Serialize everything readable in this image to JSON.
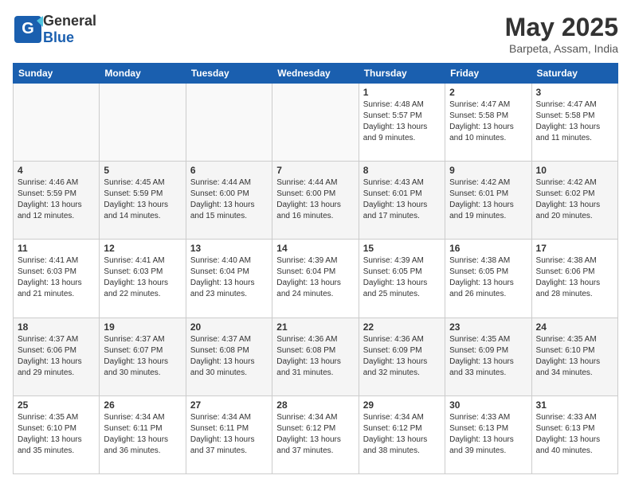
{
  "header": {
    "logo_general": "General",
    "logo_blue": "Blue",
    "month_title": "May 2025",
    "location": "Barpeta, Assam, India"
  },
  "days_of_week": [
    "Sunday",
    "Monday",
    "Tuesday",
    "Wednesday",
    "Thursday",
    "Friday",
    "Saturday"
  ],
  "weeks": [
    [
      {
        "day": "",
        "info": ""
      },
      {
        "day": "",
        "info": ""
      },
      {
        "day": "",
        "info": ""
      },
      {
        "day": "",
        "info": ""
      },
      {
        "day": "1",
        "info": "Sunrise: 4:48 AM\nSunset: 5:57 PM\nDaylight: 13 hours\nand 9 minutes."
      },
      {
        "day": "2",
        "info": "Sunrise: 4:47 AM\nSunset: 5:58 PM\nDaylight: 13 hours\nand 10 minutes."
      },
      {
        "day": "3",
        "info": "Sunrise: 4:47 AM\nSunset: 5:58 PM\nDaylight: 13 hours\nand 11 minutes."
      }
    ],
    [
      {
        "day": "4",
        "info": "Sunrise: 4:46 AM\nSunset: 5:59 PM\nDaylight: 13 hours\nand 12 minutes."
      },
      {
        "day": "5",
        "info": "Sunrise: 4:45 AM\nSunset: 5:59 PM\nDaylight: 13 hours\nand 14 minutes."
      },
      {
        "day": "6",
        "info": "Sunrise: 4:44 AM\nSunset: 6:00 PM\nDaylight: 13 hours\nand 15 minutes."
      },
      {
        "day": "7",
        "info": "Sunrise: 4:44 AM\nSunset: 6:00 PM\nDaylight: 13 hours\nand 16 minutes."
      },
      {
        "day": "8",
        "info": "Sunrise: 4:43 AM\nSunset: 6:01 PM\nDaylight: 13 hours\nand 17 minutes."
      },
      {
        "day": "9",
        "info": "Sunrise: 4:42 AM\nSunset: 6:01 PM\nDaylight: 13 hours\nand 19 minutes."
      },
      {
        "day": "10",
        "info": "Sunrise: 4:42 AM\nSunset: 6:02 PM\nDaylight: 13 hours\nand 20 minutes."
      }
    ],
    [
      {
        "day": "11",
        "info": "Sunrise: 4:41 AM\nSunset: 6:03 PM\nDaylight: 13 hours\nand 21 minutes."
      },
      {
        "day": "12",
        "info": "Sunrise: 4:41 AM\nSunset: 6:03 PM\nDaylight: 13 hours\nand 22 minutes."
      },
      {
        "day": "13",
        "info": "Sunrise: 4:40 AM\nSunset: 6:04 PM\nDaylight: 13 hours\nand 23 minutes."
      },
      {
        "day": "14",
        "info": "Sunrise: 4:39 AM\nSunset: 6:04 PM\nDaylight: 13 hours\nand 24 minutes."
      },
      {
        "day": "15",
        "info": "Sunrise: 4:39 AM\nSunset: 6:05 PM\nDaylight: 13 hours\nand 25 minutes."
      },
      {
        "day": "16",
        "info": "Sunrise: 4:38 AM\nSunset: 6:05 PM\nDaylight: 13 hours\nand 26 minutes."
      },
      {
        "day": "17",
        "info": "Sunrise: 4:38 AM\nSunset: 6:06 PM\nDaylight: 13 hours\nand 28 minutes."
      }
    ],
    [
      {
        "day": "18",
        "info": "Sunrise: 4:37 AM\nSunset: 6:06 PM\nDaylight: 13 hours\nand 29 minutes."
      },
      {
        "day": "19",
        "info": "Sunrise: 4:37 AM\nSunset: 6:07 PM\nDaylight: 13 hours\nand 30 minutes."
      },
      {
        "day": "20",
        "info": "Sunrise: 4:37 AM\nSunset: 6:08 PM\nDaylight: 13 hours\nand 30 minutes."
      },
      {
        "day": "21",
        "info": "Sunrise: 4:36 AM\nSunset: 6:08 PM\nDaylight: 13 hours\nand 31 minutes."
      },
      {
        "day": "22",
        "info": "Sunrise: 4:36 AM\nSunset: 6:09 PM\nDaylight: 13 hours\nand 32 minutes."
      },
      {
        "day": "23",
        "info": "Sunrise: 4:35 AM\nSunset: 6:09 PM\nDaylight: 13 hours\nand 33 minutes."
      },
      {
        "day": "24",
        "info": "Sunrise: 4:35 AM\nSunset: 6:10 PM\nDaylight: 13 hours\nand 34 minutes."
      }
    ],
    [
      {
        "day": "25",
        "info": "Sunrise: 4:35 AM\nSunset: 6:10 PM\nDaylight: 13 hours\nand 35 minutes."
      },
      {
        "day": "26",
        "info": "Sunrise: 4:34 AM\nSunset: 6:11 PM\nDaylight: 13 hours\nand 36 minutes."
      },
      {
        "day": "27",
        "info": "Sunrise: 4:34 AM\nSunset: 6:11 PM\nDaylight: 13 hours\nand 37 minutes."
      },
      {
        "day": "28",
        "info": "Sunrise: 4:34 AM\nSunset: 6:12 PM\nDaylight: 13 hours\nand 37 minutes."
      },
      {
        "day": "29",
        "info": "Sunrise: 4:34 AM\nSunset: 6:12 PM\nDaylight: 13 hours\nand 38 minutes."
      },
      {
        "day": "30",
        "info": "Sunrise: 4:33 AM\nSunset: 6:13 PM\nDaylight: 13 hours\nand 39 minutes."
      },
      {
        "day": "31",
        "info": "Sunrise: 4:33 AM\nSunset: 6:13 PM\nDaylight: 13 hours\nand 40 minutes."
      }
    ]
  ]
}
